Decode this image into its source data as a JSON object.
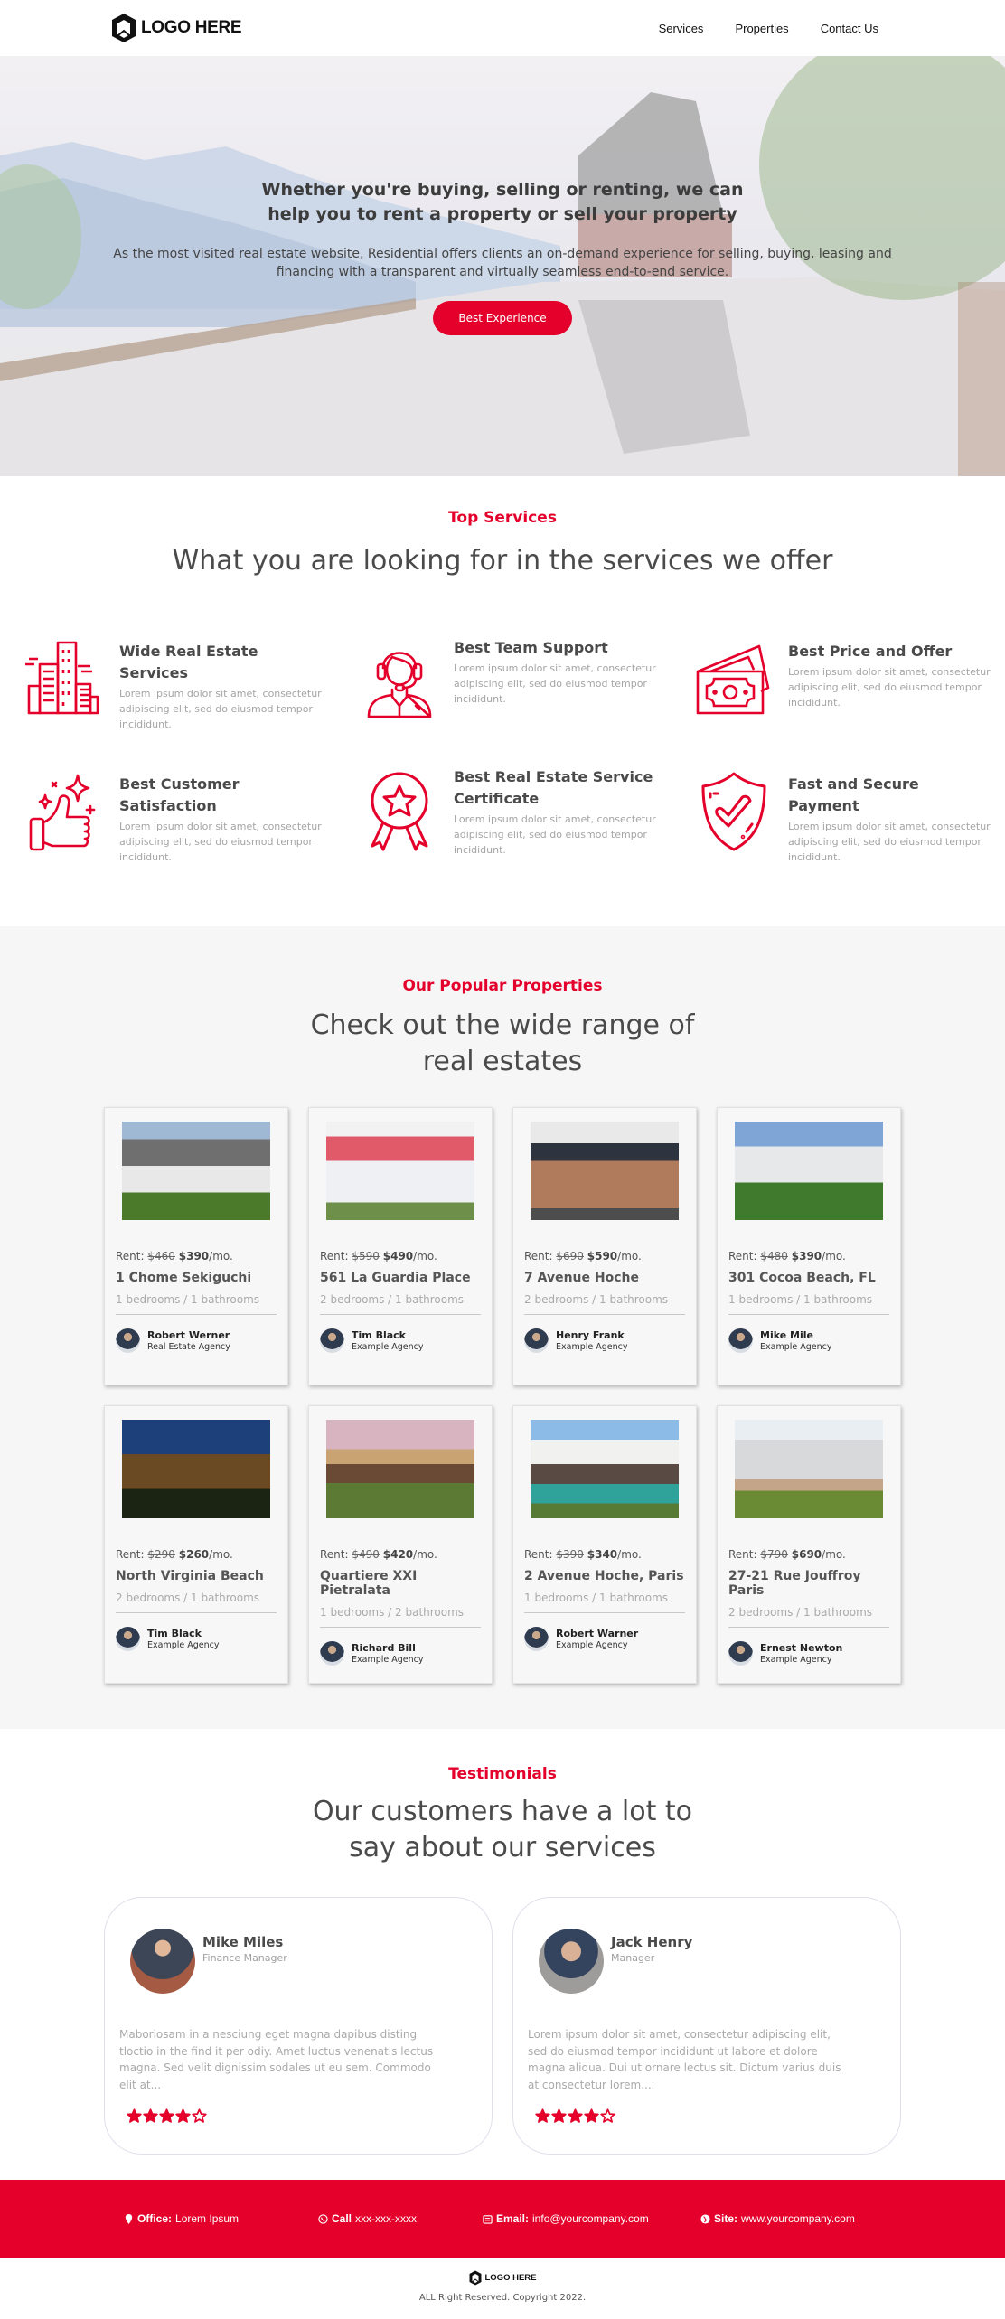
{
  "header": {
    "logo_text": "LOGO HERE",
    "nav": [
      "Services",
      "Properties",
      "Contact Us"
    ]
  },
  "hero": {
    "title": "Whether you're buying, selling or renting, we can help you to rent a property or sell your property",
    "text": "As the most visited real estate website, Residential offers clients an on-demand experience for selling, buying, leasing and financing with a transparent and virtually seamless end-to-end service.",
    "button": "Best Experience"
  },
  "services": {
    "eyebrow": "Top Services",
    "title": "What you are looking for in the services we offer",
    "items": [
      {
        "icon": "buildings-icon",
        "title": "Wide Real Estate Services",
        "desc": "Lorem ipsum dolor sit amet, consectetur adipiscing elit, sed do eiusmod tempor incididunt."
      },
      {
        "icon": "headset-agent-icon",
        "title": "Best Team Support",
        "desc": "Lorem ipsum dolor sit amet, consectetur adipiscing elit, sed do eiusmod tempor incididunt."
      },
      {
        "icon": "money-icon",
        "title": "Best Price and Offer",
        "desc": "Lorem ipsum dolor sit amet, consectetur adipiscing elit, sed do eiusmod tempor incididunt."
      },
      {
        "icon": "thumbs-up-icon",
        "title": "Best Customer Satisfaction",
        "desc": "Lorem ipsum dolor sit amet, consectetur adipiscing elit, sed do eiusmod tempor incididunt."
      },
      {
        "icon": "award-badge-icon",
        "title": "Best Real Estate Service Certificate",
        "desc": "Lorem ipsum dolor sit amet, consectetur adipiscing elit, sed do eiusmod tempor incididunt."
      },
      {
        "icon": "shield-check-icon",
        "title": "Fast and Secure Payment",
        "desc": "Lorem ipsum dolor sit amet, consectetur adipiscing elit, sed do eiusmod tempor incididunt."
      }
    ]
  },
  "properties": {
    "eyebrow": "Our Popular Properties",
    "title": "Check out the wide range of real estates",
    "rent_label": "Rent:",
    "per_month": "/mo.",
    "items": [
      {
        "old_price": "$460",
        "price": "$390",
        "address": "1 Chome Sekiguchi",
        "rooms": "1 bedrooms / 1 bathrooms",
        "agent": "Robert Werner",
        "agency": "Real Estate Agency",
        "photo": "house-porch-photo"
      },
      {
        "old_price": "$590",
        "price": "$490",
        "address": "561 La Guardia Place",
        "rooms": "2 bedrooms / 1 bathrooms",
        "agent": "Tim Black",
        "agency": "Example Agency",
        "photo": "white-house-red-roof-photo"
      },
      {
        "old_price": "$690",
        "price": "$590",
        "address": "7 Avenue Hoche",
        "rooms": "2 bedrooms / 1 bathrooms",
        "agent": "Henry Frank",
        "agency": "Example Agency",
        "photo": "brick-house-photo"
      },
      {
        "old_price": "$480",
        "price": "$390",
        "address": "301 Cocoa Beach, FL",
        "rooms": "1 bedrooms / 1 bathrooms",
        "agent": "Mike Mile",
        "agency": "Example Agency",
        "photo": "white-mansion-garden-photo"
      },
      {
        "old_price": "$290",
        "price": "$260",
        "address": "North Virginia Beach",
        "rooms": "2 bedrooms / 1 bathrooms",
        "agent": "Tim Black",
        "agency": "Example Agency",
        "photo": "night-house-photo"
      },
      {
        "old_price": "$490",
        "price": "$420",
        "address": "Quartiere XXI Pietralata",
        "rooms": "1 bedrooms / 2 bathrooms",
        "agent": "Richard Bill",
        "agency": "Example Agency",
        "photo": "lodge-sunset-photo"
      },
      {
        "old_price": "$390",
        "price": "$340",
        "address": "2 Avenue Hoche, Paris",
        "rooms": "1 bedrooms / 1 bathrooms",
        "agent": "Robert Warner",
        "agency": "Example Agency",
        "photo": "modern-villa-pool-photo"
      },
      {
        "old_price": "$790",
        "price": "$690",
        "address": "27-21 Rue Jouffroy Paris",
        "rooms": "2 bedrooms / 1 bathrooms",
        "agent": "Ernest Newton",
        "agency": "Example Agency",
        "photo": "villa-lawn-photo"
      }
    ]
  },
  "testimonials": {
    "eyebrow": "Testimonials",
    "title": "Our customers have a lot to say about our services",
    "items": [
      {
        "name": "Mike Miles",
        "role": "Finance Manager",
        "text": "Maboriosam in a nesciung eget magna dapibus disting tloctio in the find it per odiy. Amet luctus venenatis lectus magna. Sed velit dignissim sodales ut eu sem. Commodo elit at...",
        "rating": 4,
        "rating_max": 5
      },
      {
        "name": "Jack Henry",
        "role": "Manager",
        "text": "Lorem ipsum dolor sit amet, consectetur adipiscing elit, sed do eiusmod tempor incididunt ut labore et dolore magna aliqua. Dui ut ornare lectus sit. Dictum varius duis at consectetur lorem....",
        "rating": 4,
        "rating_max": 5
      }
    ]
  },
  "contact": {
    "office_label": "Office:",
    "office_value": "Lorem Ipsum",
    "call_label": "Call",
    "call_value": "xxx-xxx-xxxx",
    "email_label": "Email:",
    "email_value": "info@yourcompany.com",
    "site_label": "Site:",
    "site_value": "www.yourcompany.com"
  },
  "footer": {
    "logo_text": "LOGO HERE",
    "copyright": "ALL Right Reserved. Copyright 2022."
  },
  "colors": {
    "accent": "#e4002b",
    "text": "#4a4a4a",
    "muted": "#a5a5a5",
    "section_bg": "#f6f6f6"
  }
}
